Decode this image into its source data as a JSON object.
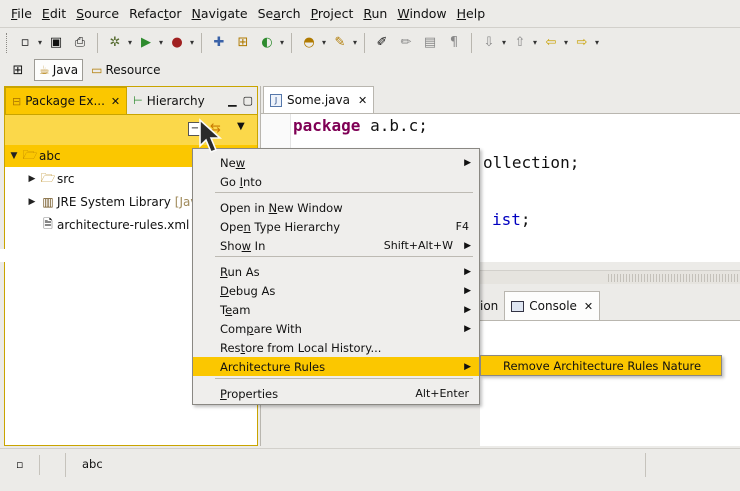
{
  "menubar": {
    "items": [
      {
        "label": "File",
        "u": "F",
        "rest": "ile"
      },
      {
        "label": "Edit",
        "u": "E",
        "rest": "dit"
      },
      {
        "label": "Source",
        "u": "S",
        "rest": "ource"
      },
      {
        "label": "Refactor",
        "pre": "Refac",
        "u": "t",
        "rest": "or"
      },
      {
        "label": "Navigate",
        "u": "N",
        "rest": "avigate"
      },
      {
        "label": "Search",
        "pre": "Se",
        "u": "a",
        "rest": "rch"
      },
      {
        "label": "Project",
        "u": "P",
        "rest": "roject"
      },
      {
        "label": "Run",
        "u": "R",
        "rest": "un"
      },
      {
        "label": "Window",
        "u": "W",
        "rest": "indow"
      },
      {
        "label": "Help",
        "u": "H",
        "rest": "elp"
      }
    ]
  },
  "perspectives": [
    {
      "label": "Java",
      "active": true,
      "icon": "java-perspective-icon"
    },
    {
      "label": "Resource",
      "active": false,
      "icon": "resource-perspective-icon"
    }
  ],
  "left_view": {
    "tabs": [
      {
        "label": "Package Ex...",
        "icon": "package-explorer-icon",
        "active": true
      },
      {
        "label": "Hierarchy",
        "icon": "hierarchy-icon",
        "active": false
      }
    ],
    "tree": [
      {
        "label": "abc",
        "suffix": "",
        "icon": "project-folder-icon",
        "expanded": true,
        "depth": 0,
        "selected": true
      },
      {
        "label": "src",
        "suffix": "",
        "icon": "source-folder-icon",
        "expanded": false,
        "depth": 1,
        "selected": false
      },
      {
        "label": "JRE System Library",
        "suffix": "[Java",
        "icon": "library-icon",
        "expanded": false,
        "depth": 1,
        "selected": false
      },
      {
        "label": "architecture-rules.xml",
        "suffix": "",
        "icon": "file-icon",
        "expanded": null,
        "depth": 1,
        "selected": false
      }
    ]
  },
  "editor": {
    "tab_label": "Some.java",
    "code": {
      "line1_kw": "package",
      "line1_rest": " a.b.c;",
      "line2": "ollection;",
      "line3_fld": "ist",
      "line3_rest": ";"
    }
  },
  "bottom_view": {
    "partial_tab": "ion",
    "console_tab": "Console"
  },
  "context_menu": {
    "items": [
      {
        "label": "New",
        "u_index": 2,
        "accel": "",
        "submenu": true
      },
      {
        "label": "Go Into",
        "u_index": 3,
        "accel": "",
        "submenu": false
      },
      {
        "label": "Open in New Window",
        "u_index": 8,
        "accel": "",
        "submenu": false
      },
      {
        "label": "Open Type Hierarchy",
        "u_index": 3,
        "accel": "F4",
        "submenu": false
      },
      {
        "label": "Show In",
        "u_index": 3,
        "accel": "Shift+Alt+W",
        "submenu": true
      },
      {
        "label": "Run As",
        "u_index": 0,
        "accel": "",
        "submenu": true
      },
      {
        "label": "Debug As",
        "u_index": 0,
        "accel": "",
        "submenu": true
      },
      {
        "label": "Team",
        "u_index": 1,
        "accel": "",
        "submenu": true
      },
      {
        "label": "Compare With",
        "u_index": 3,
        "accel": "",
        "submenu": true
      },
      {
        "label": "Restore from Local History...",
        "u_index": 3,
        "accel": "",
        "submenu": false
      },
      {
        "label": "Architecture Rules",
        "u_index": -1,
        "accel": "",
        "submenu": true,
        "highlighted": true
      },
      {
        "label": "Properties",
        "u_index": 0,
        "accel": "Alt+Enter",
        "submenu": false
      }
    ],
    "submenu_item": "Remove Architecture Rules Nature"
  },
  "status": {
    "text": "abc"
  },
  "colors": {
    "selection": "#fbc700",
    "keyword": "#7f0055",
    "field": "#0000c0"
  }
}
